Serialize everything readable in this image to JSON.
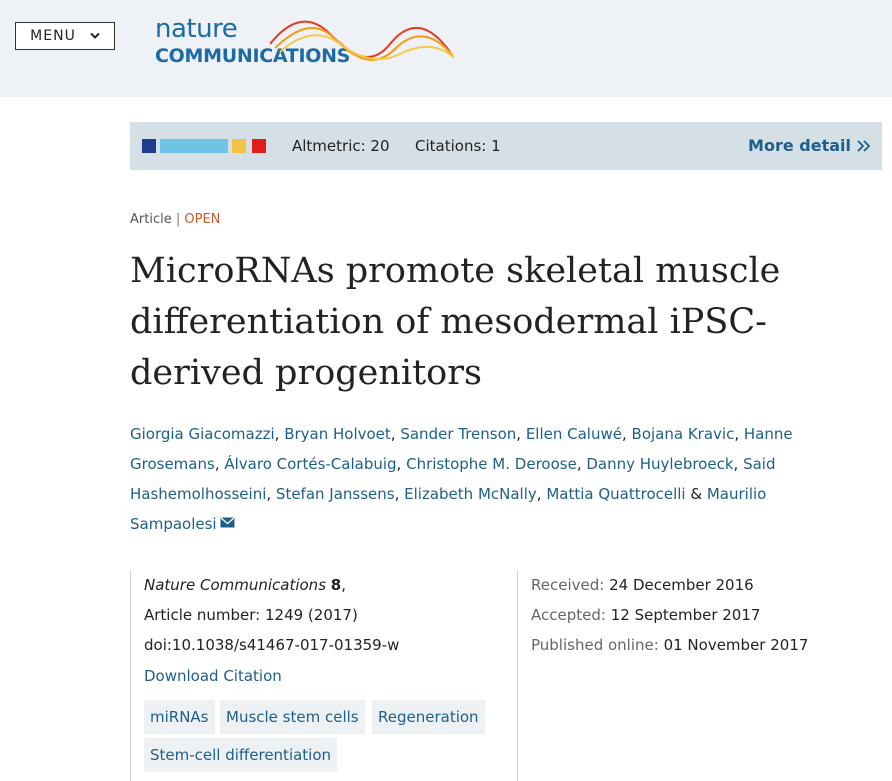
{
  "header": {
    "menu_label": "MENU",
    "logo_line1": "nature",
    "logo_line2": "COMMUNICATIONS"
  },
  "metrics": {
    "altmetric": "Altmetric: 20",
    "citations": "Citations: 1",
    "more_detail": "More detail"
  },
  "article": {
    "type": "Article",
    "separator": "|",
    "access": "OPEN",
    "title": "MicroRNAs promote skeletal muscle differentiation of mesodermal iPSC-derived progenitors",
    "authors": [
      "Giorgia Giacomazzi",
      "Bryan Holvoet",
      "Sander Trenson",
      "Ellen Caluwé",
      "Bojana Kravic",
      "Hanne Grosemans",
      "Álvaro Cortés-Calabuig",
      "Christophe M. Deroose",
      "Danny Huylebroeck",
      "Said Hashemolhosseini",
      "Stefan Janssens",
      "Elizabeth McNally",
      "Mattia Quattrocelli",
      "Maurilio Sampaolesi"
    ],
    "author_sep": ", ",
    "author_last_sep": " & "
  },
  "info": {
    "journal": "Nature Communications",
    "volume": "8",
    "volume_suffix": ",",
    "article_number": "Article number: 1249 (2017)",
    "doi": "doi:10.1038/s41467-017-01359-w",
    "download_citation": "Download Citation",
    "subjects": [
      "miRNAs",
      "Muscle stem cells",
      "Regeneration",
      "Stem-cell differentiation"
    ],
    "received_label": "Received:",
    "received": "24 December 2016",
    "accepted_label": "Accepted:",
    "accepted": "12 September 2017",
    "published_label": "Published online:",
    "published": "01 November 2017"
  },
  "colors": {
    "link": "#1d5f8a",
    "open": "#c45b2a",
    "header_bg": "#eef2f6",
    "metrics_bg": "#d4e0e6",
    "donut": [
      "#1f3d8c",
      "#6fc3e6",
      "#f5c342",
      "#e21b1b"
    ]
  },
  "icons": [
    "chevron-down-icon",
    "double-chevron-right-icon",
    "envelope-icon",
    "altmetric-bar-icon"
  ]
}
